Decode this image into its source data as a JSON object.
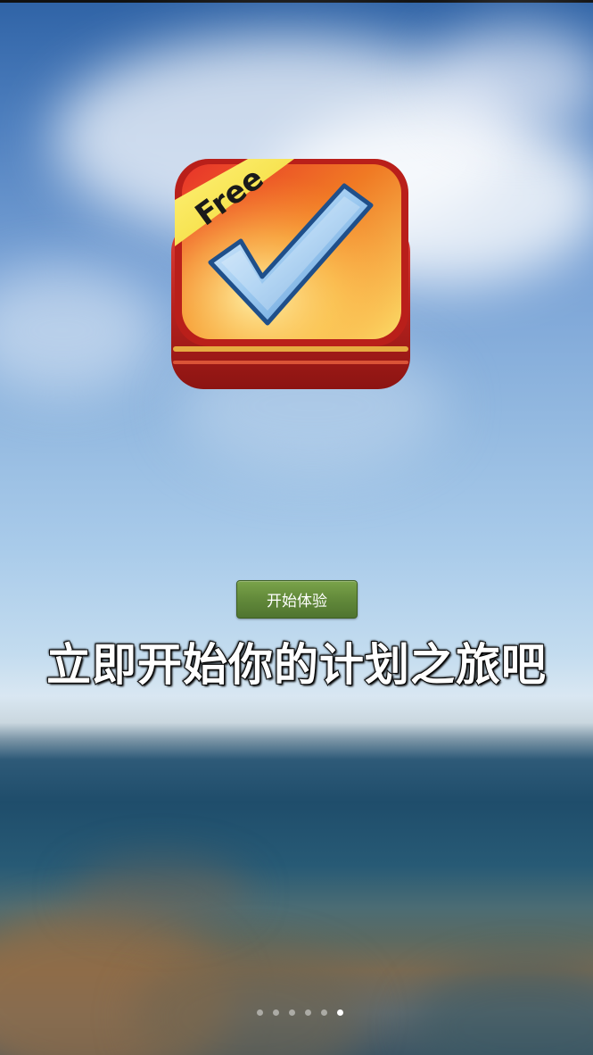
{
  "app_icon": {
    "ribbon_text": "Free",
    "icon_name": "checkmark-icon"
  },
  "cta": {
    "label": "开始体验"
  },
  "tagline": "立即开始你的计划之旅吧",
  "pager": {
    "total": 6,
    "active_index": 5
  },
  "colors": {
    "button_green": "#62893a",
    "icon_red": "#d33a2a",
    "icon_orange": "#f29a1f",
    "ribbon_yellow": "#f6e437"
  }
}
